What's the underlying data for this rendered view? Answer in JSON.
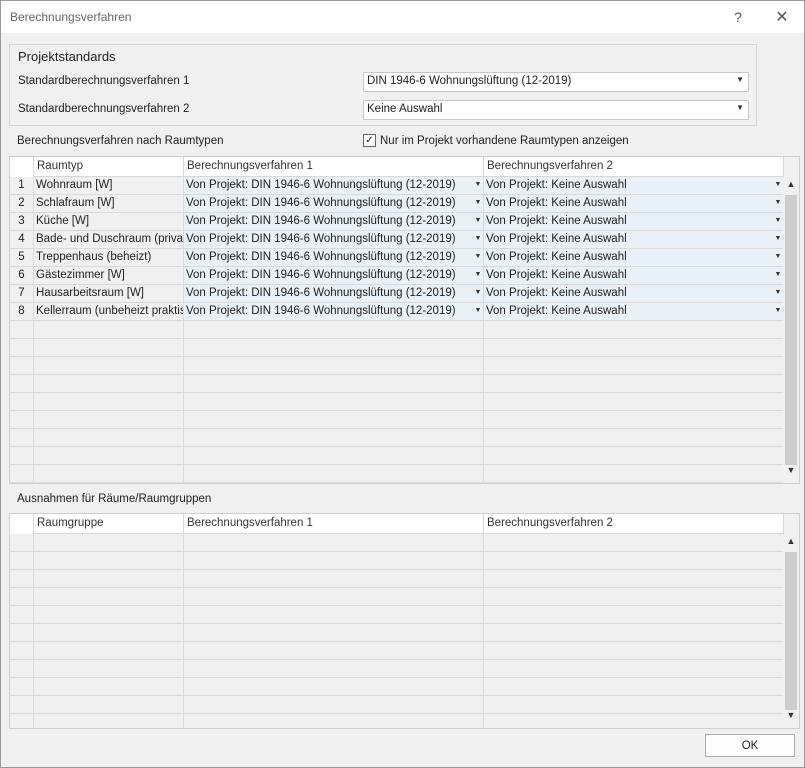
{
  "window": {
    "title": "Berechnungsverfahren",
    "help": "?",
    "close": "✕"
  },
  "projektstandards": {
    "title": "Projektstandards",
    "std1_label": "Standardberechnungsverfahren 1",
    "std1_value": "DIN 1946-6 Wohnungslüftung (12-2019)",
    "std2_label": "Standardberechnungsverfahren 2",
    "std2_value": "Keine Auswahl"
  },
  "raumtypen": {
    "section_label": "Berechnungsverfahren nach Raumtypen",
    "checkbox_label": "Nur im Projekt vorhandene Raumtypen anzeigen",
    "checkbox_checked": true,
    "headers": [
      "Raumtyp",
      "Berechnungsverfahren 1",
      "Berechnungsverfahren 2"
    ],
    "rows": [
      {
        "n": "1",
        "raumtyp": "Wohnraum [W]",
        "bv1": "Von Projekt: DIN 1946-6 Wohnungslüftung (12-2019)",
        "bv2": "Von Projekt: Keine Auswahl"
      },
      {
        "n": "2",
        "raumtyp": "Schlafraum [W]",
        "bv1": "Von Projekt: DIN 1946-6 Wohnungslüftung (12-2019)",
        "bv2": "Von Projekt: Keine Auswahl"
      },
      {
        "n": "3",
        "raumtyp": "Küche [W]",
        "bv1": "Von Projekt: DIN 1946-6 Wohnungslüftung (12-2019)",
        "bv2": "Von Projekt: Keine Auswahl"
      },
      {
        "n": "4",
        "raumtyp": "Bade- und Duschraum (priva...",
        "bv1": "Von Projekt: DIN 1946-6 Wohnungslüftung (12-2019)",
        "bv2": "Von Projekt: Keine Auswahl"
      },
      {
        "n": "5",
        "raumtyp": "Treppenhaus (beheizt)",
        "bv1": "Von Projekt: DIN 1946-6 Wohnungslüftung (12-2019)",
        "bv2": "Von Projekt: Keine Auswahl"
      },
      {
        "n": "6",
        "raumtyp": "Gästezimmer [W]",
        "bv1": "Von Projekt: DIN 1946-6 Wohnungslüftung (12-2019)",
        "bv2": "Von Projekt: Keine Auswahl"
      },
      {
        "n": "7",
        "raumtyp": "Hausarbeitsraum [W]",
        "bv1": "Von Projekt: DIN 1946-6 Wohnungslüftung (12-2019)",
        "bv2": "Von Projekt: Keine Auswahl"
      },
      {
        "n": "8",
        "raumtyp": "Kellerraum (unbeheizt praktis...",
        "bv1": "Von Projekt: DIN 1946-6 Wohnungslüftung (12-2019)",
        "bv2": "Von Projekt: Keine Auswahl"
      }
    ]
  },
  "ausnahmen": {
    "section_label": "Ausnahmen für Räume/Raumgruppen",
    "headers": [
      "Raumgruppe",
      "Berechnungsverfahren 1",
      "Berechnungsverfahren 2"
    ]
  },
  "icons": {
    "dropdown": "chevron-down-icon",
    "scroll_up": "chevron-up-icon",
    "scroll_down": "chevron-down-icon",
    "checkbox": "check-icon"
  },
  "ok_label": "OK"
}
